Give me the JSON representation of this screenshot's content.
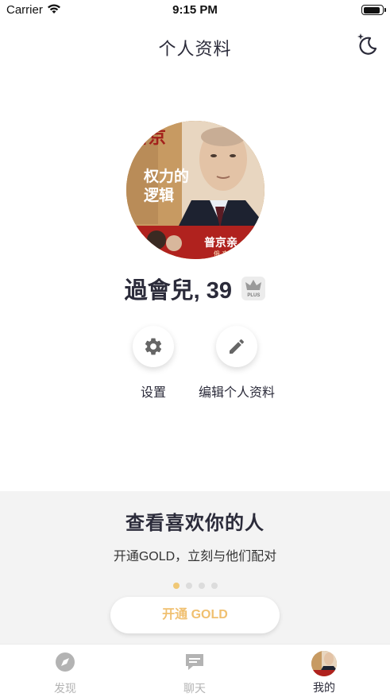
{
  "status_bar": {
    "carrier": "Carrier",
    "time": "9:15 PM",
    "battery_level": 0.9
  },
  "nav": {
    "title": "个人资料",
    "theme_icon": "moon-sparkle-icon"
  },
  "profile": {
    "name_age": "過會兒, 39",
    "badge_text": "PLUS",
    "badge_icon": "crown-icon"
  },
  "avatar_art": {
    "book_title_top": "普京",
    "book_title_main": "权力的",
    "book_title_main2": "逻辑",
    "book_title_bottom": "普京亲",
    "book_small": "俄 文"
  },
  "actions": [
    {
      "label": "设置",
      "icon": "gear-icon"
    },
    {
      "label": "编辑个人资料",
      "icon": "pencil-icon"
    }
  ],
  "promo": {
    "title": "查看喜欢你的人",
    "subtitle": "开通GOLD，立刻与他们配对",
    "pages": 4,
    "active_page": 1,
    "button_label": "开通 GOLD",
    "accent": "#f0c070"
  },
  "tabs": [
    {
      "label": "发现",
      "icon": "compass-icon",
      "active": false
    },
    {
      "label": "聊天",
      "icon": "chat-bubble-icon",
      "active": false
    },
    {
      "label": "我的",
      "icon": "avatar",
      "active": true
    }
  ]
}
